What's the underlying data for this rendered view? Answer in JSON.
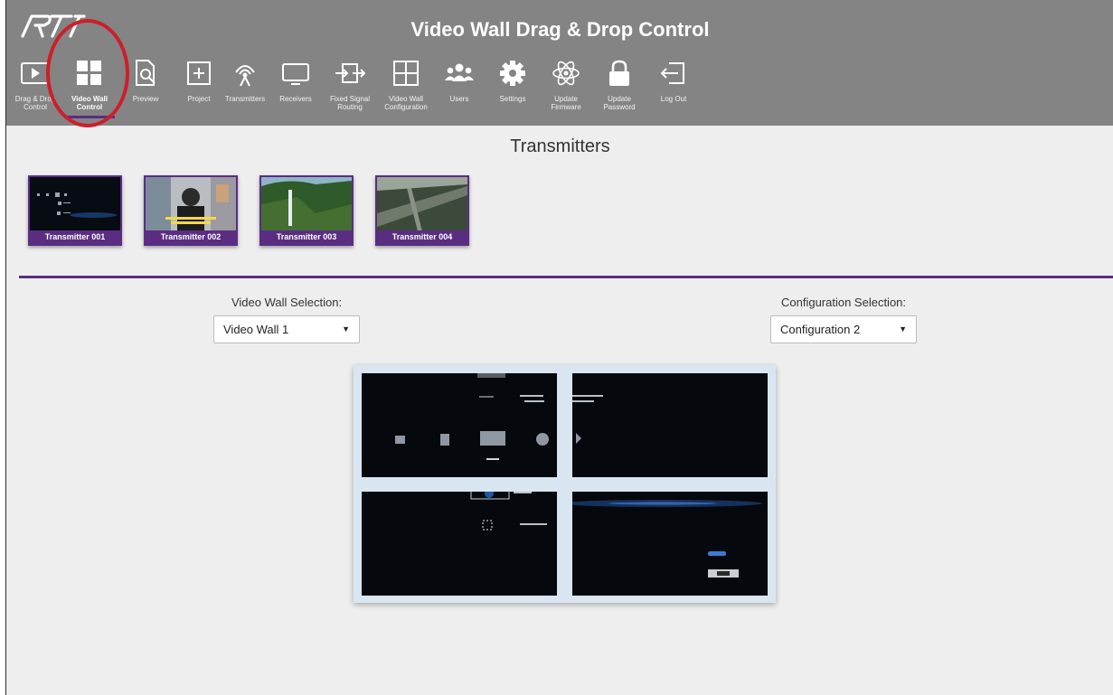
{
  "app": {
    "title": "Video Wall Drag & Drop Control",
    "logo_text": "RTI"
  },
  "nav": [
    {
      "label": "Drag & Drop\nControl",
      "icon": "play-screen-icon"
    },
    {
      "label": "Video Wall\nControl",
      "icon": "grid-icon",
      "active": true
    },
    {
      "label": "Preview",
      "icon": "preview-document-icon"
    },
    {
      "label": "Project",
      "icon": "plus-box-icon"
    },
    {
      "label": "Transmitters",
      "icon": "antenna-icon"
    },
    {
      "label": "Receivers",
      "icon": "monitor-icon"
    },
    {
      "label": "Fixed Signal\nRouting",
      "icon": "routing-icon"
    },
    {
      "label": "Video Wall\nConfiguration",
      "icon": "grid-outline-icon"
    },
    {
      "label": "Users",
      "icon": "users-icon"
    },
    {
      "label": "Settings",
      "icon": "gear-icon"
    },
    {
      "label": "Update\nFirmware",
      "icon": "atom-icon"
    },
    {
      "label": "Update\nPassword",
      "icon": "lock-icon"
    },
    {
      "label": "Log Out",
      "icon": "logout-icon"
    }
  ],
  "transmitters": {
    "title": "Transmitters",
    "items": [
      {
        "label": "Transmitter 001"
      },
      {
        "label": "Transmitter 002"
      },
      {
        "label": "Transmitter 003"
      },
      {
        "label": "Transmitter 004"
      }
    ]
  },
  "video_wall_selection": {
    "label": "Video Wall Selection:",
    "value": "Video Wall 1"
  },
  "configuration_selection": {
    "label": "Configuration Selection:",
    "value": "Configuration 2"
  },
  "colors": {
    "header_bg": "#848484",
    "accent": "#5a2d82",
    "highlight_circle": "#cc1f2b",
    "page_bg": "#eeeeee"
  }
}
